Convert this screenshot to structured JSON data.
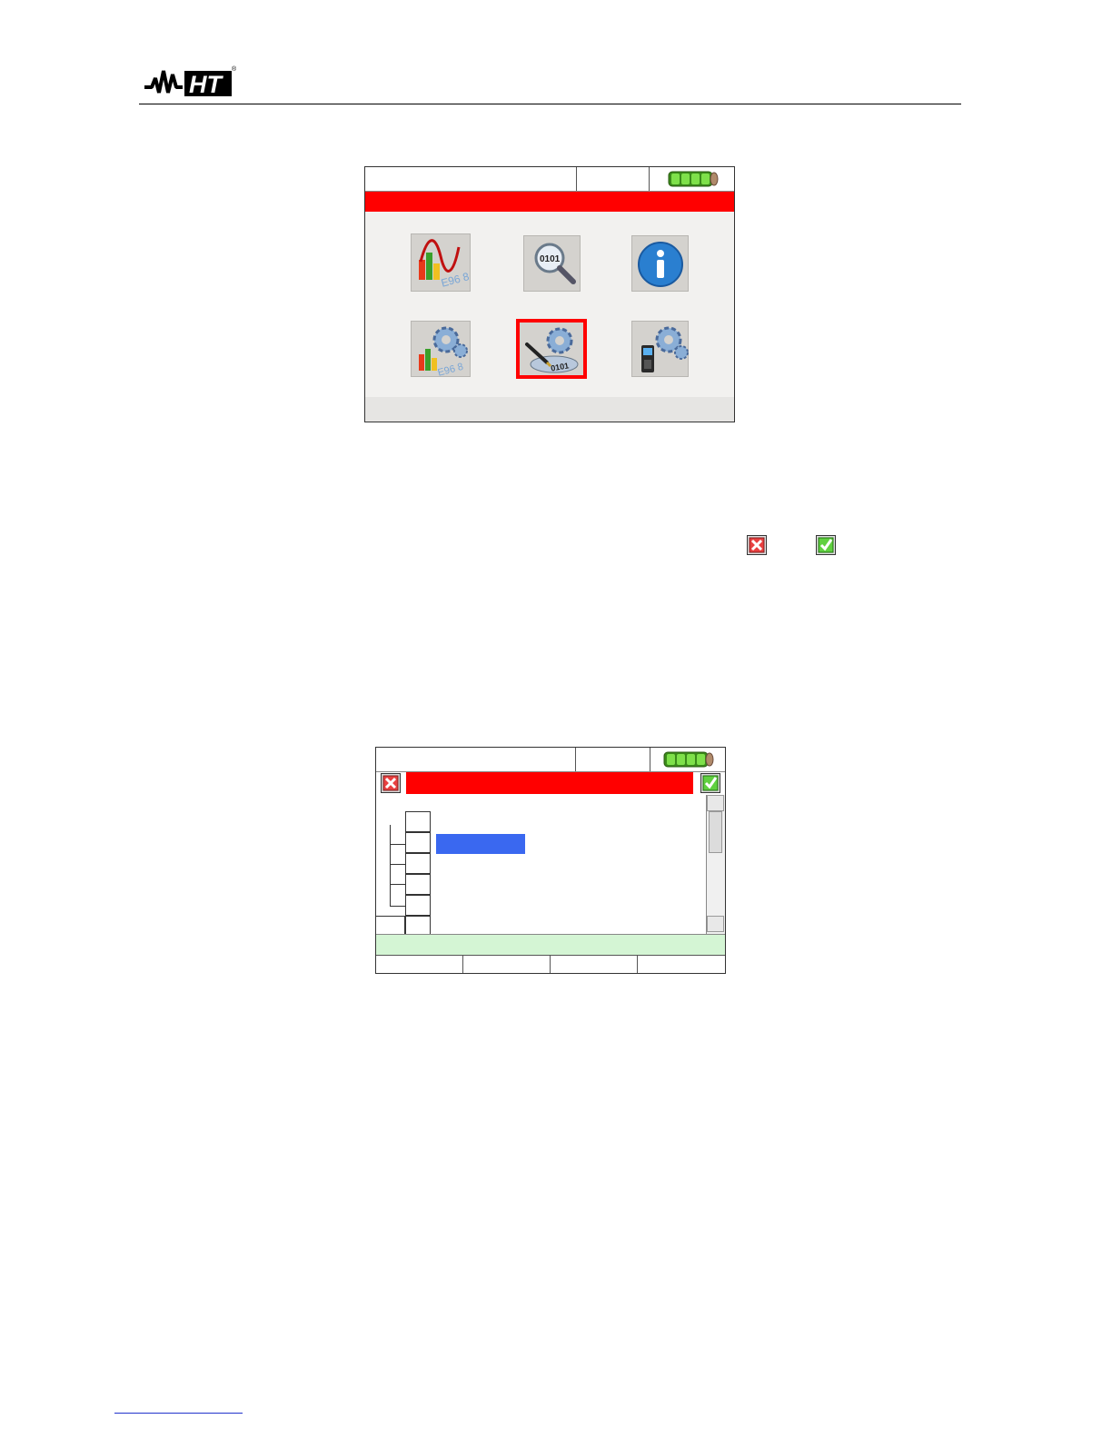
{
  "header": {
    "logo_text": "HT",
    "logo_trademark": "®"
  },
  "screen_main_menu": {
    "status": {
      "left_text": "",
      "mid_text": ""
    },
    "title": "",
    "icons": [
      {
        "name": "real-time-values-icon"
      },
      {
        "name": "recall-data-icon"
      },
      {
        "name": "info-icon"
      },
      {
        "name": "analyzer-settings-icon"
      },
      {
        "name": "recording-settings-icon"
      },
      {
        "name": "general-settings-icon"
      }
    ],
    "selected_icon": "recording-settings-icon",
    "bottom_text": ""
  },
  "inline_icons": {
    "cancel": "cancel-icon",
    "confirm": "confirm-icon"
  },
  "screen_settings": {
    "status": {
      "left_text": "",
      "mid_text": ""
    },
    "title": "",
    "highlight_text": "",
    "green_bar_text": "",
    "fkeys": [
      "",
      "",
      "",
      ""
    ]
  },
  "colors": {
    "title_bar": "#ff0000",
    "selection": "#3a68f0",
    "status_green": "#d4f5d4",
    "battery_green": "#55cc22"
  }
}
